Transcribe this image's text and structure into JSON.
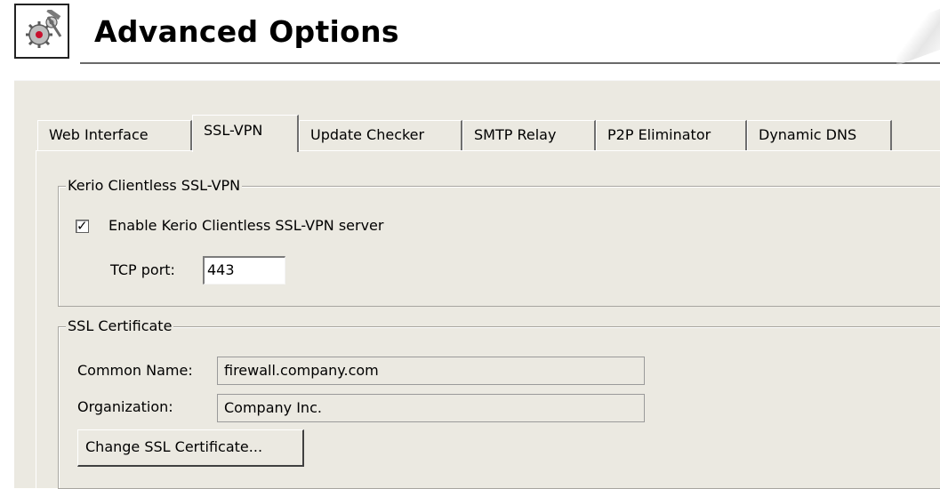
{
  "header": {
    "title": "Advanced Options",
    "icon": "gears-wrench-icon"
  },
  "tabs": [
    {
      "label": "Web Interface",
      "active": false
    },
    {
      "label": "SSL-VPN",
      "active": true
    },
    {
      "label": "Update Checker",
      "active": false
    },
    {
      "label": "SMTP Relay",
      "active": false
    },
    {
      "label": "P2P Eliminator",
      "active": false
    },
    {
      "label": "Dynamic DNS",
      "active": false
    }
  ],
  "clientless": {
    "legend": "Kerio Clientless SSL-VPN",
    "enable_label": "Enable Kerio Clientless SSL-VPN server",
    "enable_checked": true,
    "port_label": "TCP port:",
    "port_value": "443"
  },
  "certificate": {
    "legend": "SSL Certificate",
    "common_name_label": "Common Name:",
    "common_name_value": "firewall.company.com",
    "organization_label": "Organization:",
    "organization_value": "Company Inc.",
    "change_button": "Change SSL Certificate..."
  },
  "colors": {
    "dialog_bg": "#ebe9e1",
    "accent_red": "#c8102e"
  }
}
